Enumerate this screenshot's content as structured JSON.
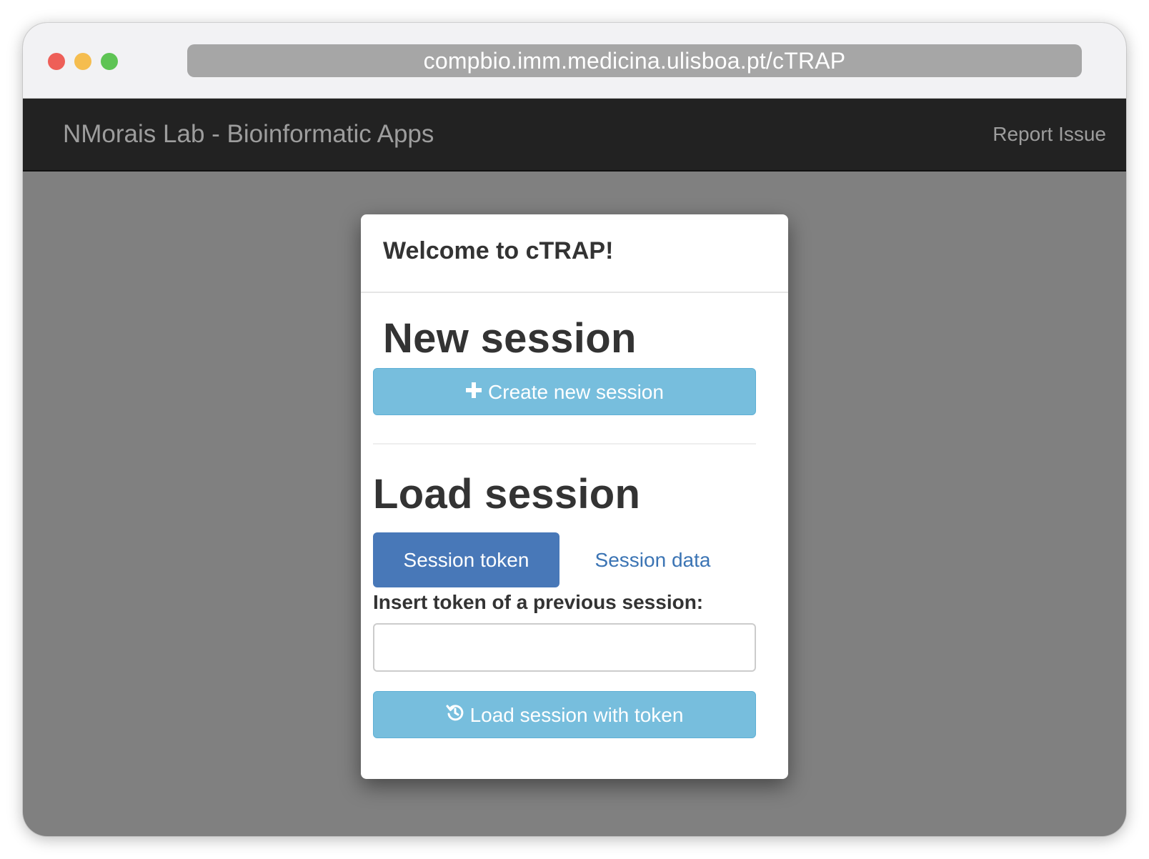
{
  "browser": {
    "url": "compbio.imm.medicina.ulisboa.pt/cTRAP",
    "traffic_lights": {
      "close_color": "#ee5f58",
      "minimize_color": "#f5bd4f",
      "maximize_color": "#5ec454"
    }
  },
  "navbar": {
    "brand": "NMorais Lab - Bioinformatic Apps",
    "report_link": "Report Issue"
  },
  "modal": {
    "title": "Welcome to cTRAP!",
    "new_session": {
      "heading": "New session",
      "button_label": "Create new session",
      "button_icon": "plus-icon"
    },
    "load_session": {
      "heading": "Load session",
      "tabs": [
        {
          "label": "Session token",
          "active": true
        },
        {
          "label": "Session data",
          "active": false
        }
      ],
      "token_label": "Insert token of a previous session:",
      "token_value": "",
      "button_label": "Load session with token",
      "button_icon": "history-icon"
    }
  },
  "colors": {
    "navbar_bg": "#222222",
    "backdrop": "#808080",
    "info_button": "#77bedd",
    "active_tab": "#4878b8",
    "link": "#3b74b4"
  }
}
